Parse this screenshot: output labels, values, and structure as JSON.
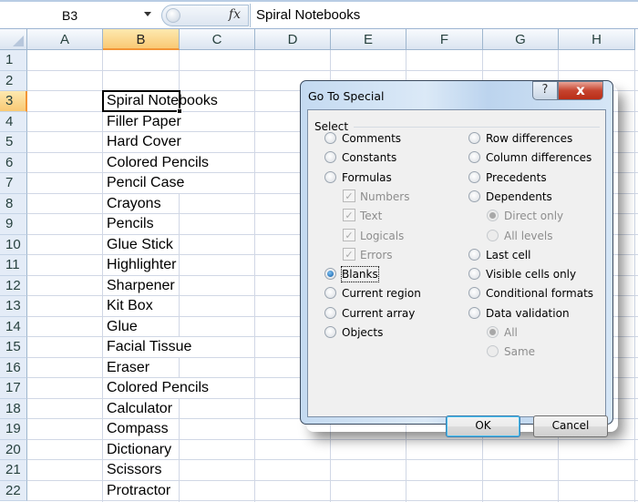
{
  "formula_bar": {
    "name_box": "B3",
    "fx_label": "fx",
    "content": "Spiral Notebooks"
  },
  "columns": [
    "A",
    "B",
    "C",
    "D",
    "E",
    "F",
    "G",
    "H"
  ],
  "selected_column": "B",
  "rows": [
    "1",
    "2",
    "3",
    "4",
    "5",
    "6",
    "7",
    "8",
    "9",
    "10",
    "11",
    "12",
    "13",
    "14",
    "15",
    "16",
    "17",
    "18",
    "19",
    "20",
    "21",
    "22"
  ],
  "selected_row": "3",
  "active_cell": "B3",
  "column_b": [
    "",
    "",
    "Spiral Notebooks",
    "Filler Paper",
    "Hard Cover",
    "Colored Pencils",
    "Pencil Case",
    "Crayons",
    "Pencils",
    "Glue Stick",
    "Highlighter",
    "Sharpener",
    "Kit Box",
    "Glue",
    "Facial Tissue",
    "Eraser",
    "Colored Pencils",
    "Calculator",
    "Compass",
    "Dictionary",
    "Scissors",
    "Protractor"
  ],
  "dialog": {
    "title": "Go To Special",
    "help_label": "?",
    "close_label": "x",
    "group_label": "Select",
    "left_options": [
      {
        "label": "Comments",
        "type": "radio",
        "checked": false,
        "enabled": true
      },
      {
        "label": "Constants",
        "type": "radio",
        "checked": false,
        "enabled": true
      },
      {
        "label": "Formulas",
        "type": "radio",
        "checked": false,
        "enabled": true
      },
      {
        "label": "Numbers",
        "type": "checkbox",
        "checked": true,
        "enabled": false
      },
      {
        "label": "Text",
        "type": "checkbox",
        "checked": true,
        "enabled": false
      },
      {
        "label": "Logicals",
        "type": "checkbox",
        "checked": true,
        "enabled": false
      },
      {
        "label": "Errors",
        "type": "checkbox",
        "checked": true,
        "enabled": false
      },
      {
        "label": "Blanks",
        "type": "radio",
        "checked": true,
        "enabled": true
      },
      {
        "label": "Current region",
        "type": "radio",
        "checked": false,
        "enabled": true
      },
      {
        "label": "Current array",
        "type": "radio",
        "checked": false,
        "enabled": true
      },
      {
        "label": "Objects",
        "type": "radio",
        "checked": false,
        "enabled": true
      }
    ],
    "right_options": [
      {
        "label": "Row differences",
        "type": "radio",
        "checked": false,
        "enabled": true
      },
      {
        "label": "Column differences",
        "type": "radio",
        "checked": false,
        "enabled": true
      },
      {
        "label": "Precedents",
        "type": "radio",
        "checked": false,
        "enabled": true
      },
      {
        "label": "Dependents",
        "type": "radio",
        "checked": false,
        "enabled": true
      },
      {
        "label": "Direct only",
        "type": "radio",
        "checked": true,
        "enabled": false
      },
      {
        "label": "All levels",
        "type": "radio",
        "checked": false,
        "enabled": false
      },
      {
        "label": "Last cell",
        "type": "radio",
        "checked": false,
        "enabled": true
      },
      {
        "label": "Visible cells only",
        "type": "radio",
        "checked": false,
        "enabled": true
      },
      {
        "label": "Conditional formats",
        "type": "radio",
        "checked": false,
        "enabled": true
      },
      {
        "label": "Data validation",
        "type": "radio",
        "checked": false,
        "enabled": true
      },
      {
        "label": "All",
        "type": "radio",
        "checked": true,
        "enabled": false
      },
      {
        "label": "Same",
        "type": "radio",
        "checked": false,
        "enabled": false
      }
    ],
    "ok_label": "OK",
    "cancel_label": "Cancel"
  },
  "colors": {
    "selection_header": "#f9c974",
    "selection_accent": "#f29436",
    "header_bg": "#dbe5f1",
    "gridline": "#d0d7e5",
    "close_button": "#c6432e",
    "radio_selected": "#0c5aa6"
  }
}
